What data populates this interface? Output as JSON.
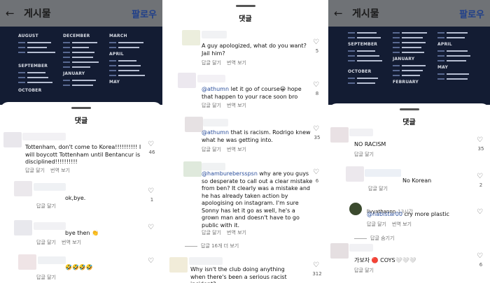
{
  "screens": {
    "left": {
      "header": {
        "title": "게시물",
        "follow": "팔로우"
      },
      "poster": {
        "months_col1": [
          "AUGUST",
          "SEPTEMBER",
          "OCTOBER"
        ],
        "months_col2": [
          "DECEMBER",
          "JANUARY"
        ],
        "months_col3": [
          "MARCH",
          "APRIL",
          "MAY"
        ]
      },
      "sheet_title": "댓글",
      "comments": [
        {
          "text": "Tottenham, don't come to Korea!!!!!!!!!! I will boycott Tottenham until Bentancur is disciplined!!!!!!!!!!",
          "reply": "답글 달기",
          "translate": "번역 보기",
          "likes": "46"
        },
        {
          "text": "ok,bye.",
          "reply": "답글 달기",
          "likes": "1"
        },
        {
          "text": "bye then 👏",
          "reply": "답글 달기",
          "translate": "번역 보기",
          "likes": ""
        },
        {
          "text": "🤣🤣🤣🤣",
          "reply": "답글 달기",
          "likes": ""
        }
      ]
    },
    "middle": {
      "sheet_title": "댓글",
      "comments": [
        {
          "text": "A guy apologized, what do you want? Jail him?",
          "reply": "답글 달기",
          "translate": "번역 보기",
          "likes": "5"
        },
        {
          "mention": "@athumn",
          "text": " let it go of course😀 hope that happen to your race soon bro",
          "reply": "답글 달기",
          "translate": "번역 보기",
          "likes": "8"
        },
        {
          "mention": "@athumn",
          "text": " that is racism. Rodrigo knew what he was getting into.",
          "reply": "답글 달기",
          "translate": "번역 보기",
          "likes": "35"
        },
        {
          "mention": "@hamburebersspsn",
          "text": " why are you guys so desperate to call out a clear mistake from ben? It clearly was a mistake and he has already taken action by apologising on instagram. I'm sure Sonny has let it go as well, he's a grown man and doesn't have to go public with it.",
          "reply": "답글 달기",
          "translate": "번역 보기",
          "likes": "6",
          "more_replies": "답글 16개 더 보기"
        },
        {
          "text": "Why isn't the club doing anything when there's been a serious racist incident?",
          "likes": "312"
        }
      ]
    },
    "right": {
      "header": {
        "title": "게시물",
        "follow": "팔로우"
      },
      "poster": {
        "months_col1": [
          "SEPTEMBER",
          "OCTOBER"
        ],
        "months_col2": [
          "JANUARY",
          "FEBRUARY"
        ],
        "months_col3": [
          "APRIL",
          "MAY"
        ]
      },
      "sheet_title": "댓글",
      "comments": [
        {
          "text": "NO RACISM",
          "reply": "답글 달기",
          "likes": "35"
        },
        {
          "text": "No Korean",
          "reply": "답글 달기",
          "likes": "2"
        },
        {
          "username": "livyathannn",
          "time": "13시간",
          "mention": "@nabistar00",
          "text": " cry more plastic",
          "reply": "답글 달기",
          "translate": "번역 보기",
          "likes": ""
        },
        {
          "replies_link": "답글 숨기기"
        },
        {
          "text": "가보자 🔴 COYS🤍🤍🤍",
          "reply": "답글 달기",
          "likes": "6"
        }
      ]
    }
  },
  "colors": {
    "mention": "#2b4f9c",
    "poster_bg": "#131c33",
    "dim": "#7a7c80"
  }
}
